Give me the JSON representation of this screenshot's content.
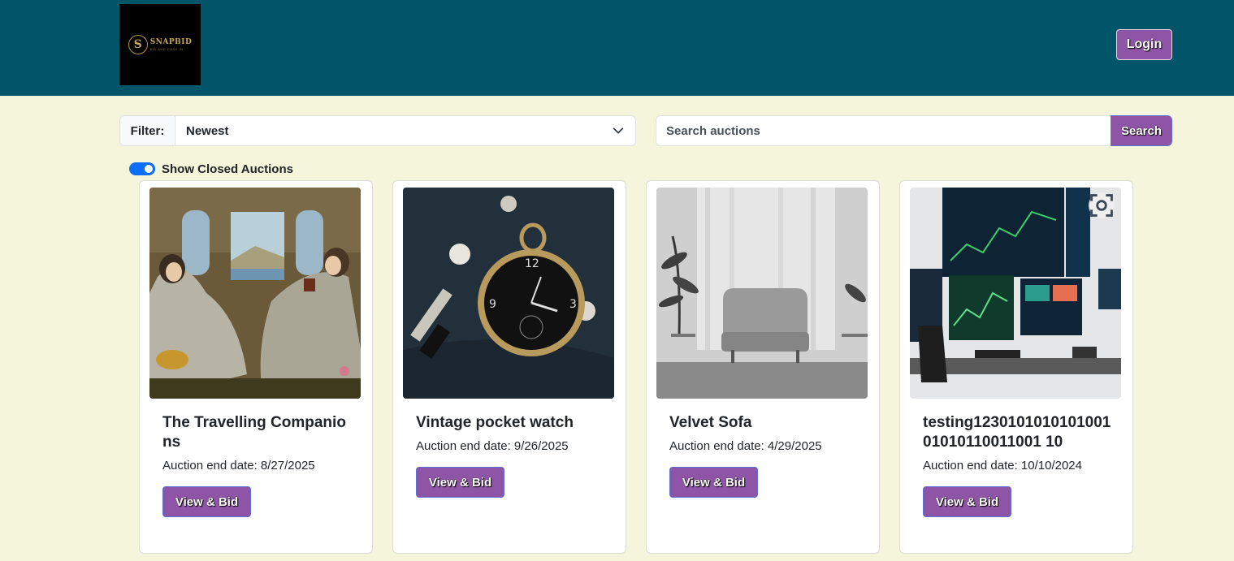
{
  "header": {
    "logo_name": "SNAPBID",
    "logo_tagline": "BID AND CASH IN",
    "logo_mark": "S",
    "login_label": "Login"
  },
  "filter": {
    "label": "Filter:",
    "selected": "Newest"
  },
  "search": {
    "placeholder": "Search auctions",
    "button_label": "Search"
  },
  "toggle": {
    "label": "Show Closed Auctions",
    "checked": true
  },
  "cards": [
    {
      "title": "The Travelling Companions",
      "date": "Auction end date: 8/27/2025",
      "button": "View & Bid",
      "image": "painting-image"
    },
    {
      "title": "Vintage pocket watch",
      "date": "Auction end date: 9/26/2025",
      "button": "View & Bid",
      "image": "pocket-watch-image"
    },
    {
      "title": "Velvet Sofa",
      "date": "Auction end date: 4/29/2025",
      "button": "View & Bid",
      "image": "sofa-image"
    },
    {
      "title": "testing123010101010100101010110011001 10",
      "date": "Auction end date: 10/10/2024",
      "button": "View & Bid",
      "image": "trading-desk-image"
    }
  ],
  "colors": {
    "header_bg": "#005569",
    "page_bg": "#f5f5dc",
    "button_purple": "#8e55a6",
    "toggle_blue": "#0d6efd"
  }
}
